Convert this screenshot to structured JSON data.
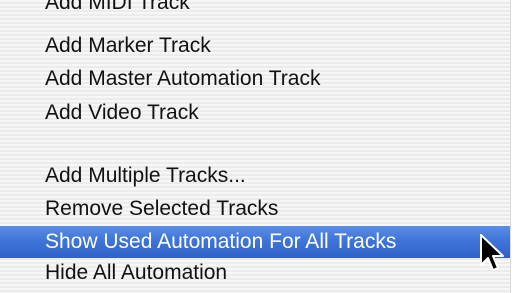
{
  "menu": {
    "items": [
      {
        "label": "Add MIDI Track"
      },
      {
        "label": "Add Marker Track"
      },
      {
        "label": "Add Master Automation Track"
      },
      {
        "label": "Add Video Track"
      },
      {
        "label": "Add Multiple Tracks..."
      },
      {
        "label": "Remove Selected Tracks"
      },
      {
        "label": "Show Used Automation For All Tracks"
      },
      {
        "label": "Hide All Automation"
      }
    ],
    "selected_label": "Show Used Automation For All Tracks",
    "highlight_color": "#3f74d8"
  },
  "cursor": {
    "icon": "arrow-pointer-icon"
  }
}
